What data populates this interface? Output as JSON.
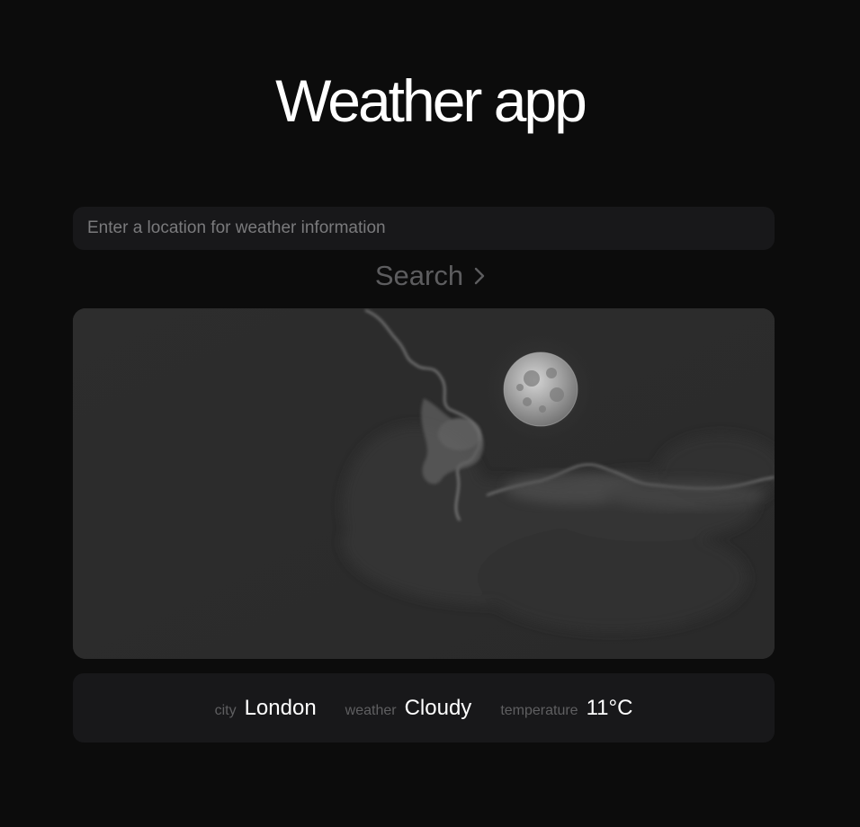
{
  "app": {
    "title": "Weather app"
  },
  "search": {
    "placeholder": "Enter a location for weather information",
    "value": "",
    "button_label": "Search"
  },
  "result": {
    "city_label": "city",
    "city": "London",
    "weather_label": "weather",
    "weather": "Cloudy",
    "temperature_label": "temperature",
    "temperature": "11°C"
  },
  "icons": {
    "search_button": "chevron-right-icon"
  },
  "colors": {
    "background": "#0c0c0c",
    "panel": "#18181a",
    "text": "#ffffff",
    "muted": "#5f5f61"
  }
}
